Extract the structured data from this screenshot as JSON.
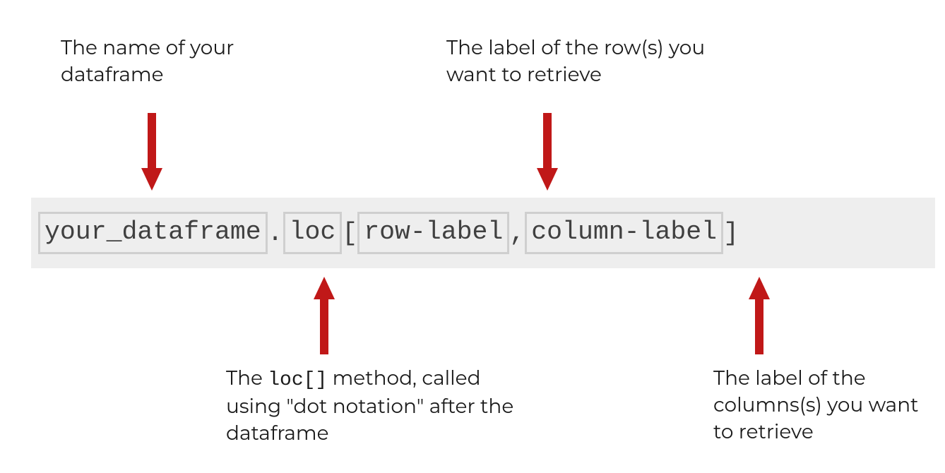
{
  "annotations": {
    "topLeft": "The name of your dataframe",
    "topRight": "The label of the row(s) you want to retrieve",
    "bottomLeft_pre": "The ",
    "bottomLeft_code": "loc[]",
    "bottomLeft_post": " method, called using \"dot notation\" after the dataframe",
    "bottomRight": "The label of the columns(s) you want to retrieve"
  },
  "code": {
    "part1": "your_dataframe",
    "dot": ".",
    "part2": "loc",
    "open": "[",
    "part3": "row-label",
    "comma": ",",
    "part4": "column-label",
    "close": "]"
  },
  "arrowColor": "#c01818"
}
